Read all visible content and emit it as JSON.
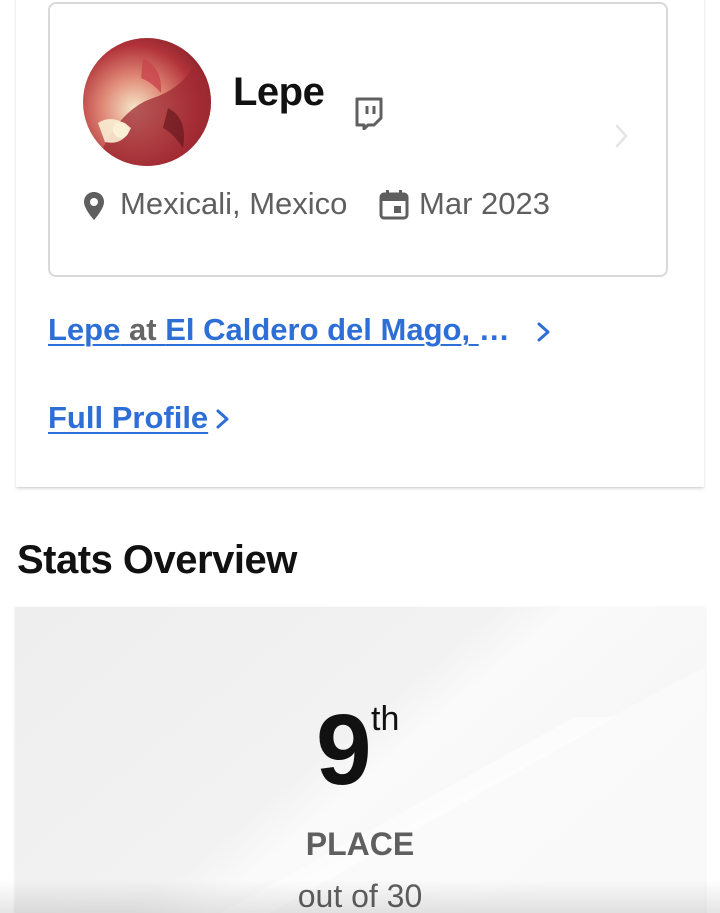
{
  "profile": {
    "name": "Lepe",
    "avatar_icon": "player-avatar",
    "stream_icon": "twitch-icon",
    "location": "Mexicali, Mexico",
    "joined": "Mar 2023"
  },
  "links": {
    "team_player": "Lepe",
    "team_at": "at",
    "team_name": "El Caldero del Mago, S...",
    "full_profile": "Full Profile"
  },
  "stats": {
    "section_title": "Stats Overview",
    "place_number": "9",
    "place_suffix": "th",
    "place_label": "PLACE",
    "place_total": "out of 30"
  },
  "colors": {
    "link": "#2d6fd6",
    "muted_text": "#5f5f5f",
    "heading": "#111111"
  }
}
